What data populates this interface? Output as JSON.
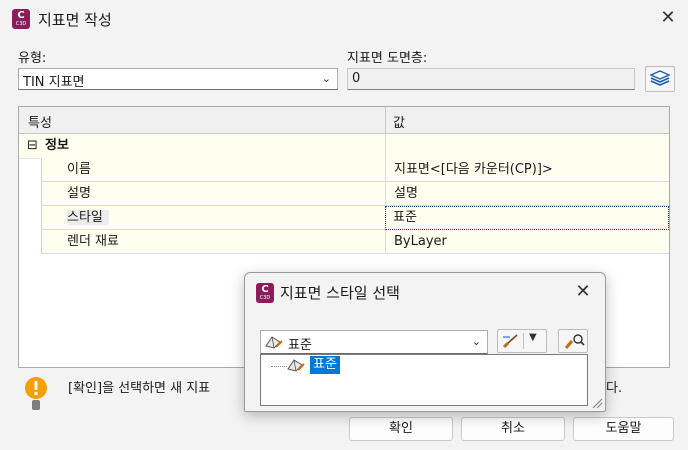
{
  "dialog": {
    "title": "지표면 작성",
    "app_icon": {
      "letter": "C",
      "sub": "C3D"
    }
  },
  "type_field": {
    "label": "유형:",
    "value": "TIN 지표면"
  },
  "layer_field": {
    "label": "지표면 도면층:",
    "value": "0"
  },
  "grid": {
    "headers": [
      "특성",
      "값"
    ],
    "group": {
      "expander": "⊟",
      "label": "정보"
    },
    "rows": [
      {
        "name": "이름",
        "value": "지표면<[다음 카운터(CP)]>"
      },
      {
        "name": "설명",
        "value": "설명"
      },
      {
        "name": "스타일",
        "value": "표준"
      },
      {
        "name": "렌더 재료",
        "value": "ByLayer"
      }
    ]
  },
  "info": {
    "text_start": "[확인]을 선택하면 새 지표",
    "text_end": "다."
  },
  "buttons": {
    "ok": "확인",
    "cancel": "취소",
    "help": "도움말"
  },
  "style_picker": {
    "title": "지표면 스타일 선택",
    "selected": "표준",
    "tree_items": [
      "표준"
    ]
  },
  "colors": {
    "app_icon": "#8b1d5c",
    "selection": "#0078d7",
    "warn": "#f5a000",
    "property_row": "#fffff0"
  }
}
